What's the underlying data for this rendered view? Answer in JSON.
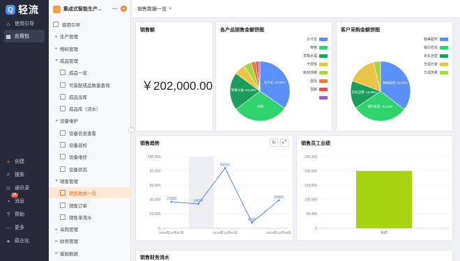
{
  "rail": {
    "logo_text": "轻流",
    "items_top": [
      {
        "label": "使用引导",
        "icon": "home-icon"
      },
      {
        "label": "应用包",
        "icon": "grid-icon"
      }
    ],
    "items_bottom": [
      {
        "label": "创建",
        "icon": "plus-icon"
      },
      {
        "label": "搜索",
        "icon": "search-icon"
      },
      {
        "label": "通讯录",
        "icon": "contacts-icon"
      },
      {
        "label": "消息",
        "icon": "bell-icon",
        "badge": "38"
      },
      {
        "label": "帮助",
        "icon": "help-icon"
      },
      {
        "label": "更多",
        "icon": "more-icon"
      },
      {
        "label": "薛业化",
        "icon": "avatar"
      }
    ]
  },
  "sidebar": {
    "app_name": "集成式智能生产...",
    "more": "···",
    "add": "+",
    "items": [
      {
        "label": "使用引导",
        "level": 1,
        "type": "leaf"
      },
      {
        "label": "生产管理",
        "level": 1,
        "type": "group",
        "open": false
      },
      {
        "label": "物料管理",
        "level": 1,
        "type": "group",
        "open": false
      },
      {
        "label": "成品管理",
        "level": 1,
        "type": "group",
        "open": true
      },
      {
        "label": "成品一览",
        "level": 2,
        "type": "leaf"
      },
      {
        "label": "可装配成品数量查询",
        "level": 2,
        "type": "leaf"
      },
      {
        "label": "成品出库",
        "level": 2,
        "type": "leaf"
      },
      {
        "label": "成品库（流水）",
        "level": 2,
        "type": "leaf"
      },
      {
        "label": "设备维护",
        "level": 1,
        "type": "group",
        "open": true
      },
      {
        "label": "设备信息查看",
        "level": 2,
        "type": "leaf"
      },
      {
        "label": "设备巡检",
        "level": 2,
        "type": "leaf"
      },
      {
        "label": "设备维修",
        "level": 2,
        "type": "leaf"
      },
      {
        "label": "设备状态",
        "level": 2,
        "type": "leaf"
      },
      {
        "label": "销售管理",
        "level": 1,
        "type": "group",
        "open": true
      },
      {
        "label": "销售数据一览",
        "level": 2,
        "type": "leaf",
        "selected": true
      },
      {
        "label": "销售订单",
        "level": 2,
        "type": "leaf"
      },
      {
        "label": "销售单流水",
        "level": 2,
        "type": "leaf"
      },
      {
        "label": "采购管理",
        "level": 1,
        "type": "group",
        "open": false
      },
      {
        "label": "财务管理",
        "level": 1,
        "type": "group",
        "open": false
      },
      {
        "label": "基础数据",
        "level": 1,
        "type": "group",
        "open": false
      }
    ]
  },
  "topbar": {
    "title": "销售数据一览"
  },
  "cards": {
    "sales_amount": {
      "title": "销售额",
      "value": "￥202,000.00"
    },
    "product_pie": {
      "title": "各产品销售金额饼图"
    },
    "customer_pie": {
      "title": "客户采购金额饼图"
    },
    "trend": {
      "title": "销售趋势"
    },
    "salesperson": {
      "title": "销售员工业绩"
    },
    "finance": {
      "title": "销售财务流水"
    }
  },
  "chart_data": [
    {
      "type": "pie",
      "title": "各产品销售金额饼图",
      "categories": [
        "马卡龙",
        "枣糕",
        "草莓大福",
        "千层饼",
        "桃林馒糕",
        "蛋挞",
        "蛋酥",
        ""
      ],
      "values": [
        34.65,
        30.0,
        20.5,
        6.0,
        4.0,
        2.5,
        1.5,
        0.85
      ],
      "slice_labels": [
        "马卡龙: 34.65%",
        "枣糕",
        "草莓大福: 20.53%",
        "",
        "",
        "",
        "",
        ""
      ],
      "colors": [
        "#5b8ff9",
        "#2fd36b",
        "#1b9e5b",
        "#e8c547",
        "#a5d63f",
        "#e87b3f",
        "#e0524a",
        "#9b59c9"
      ],
      "legend_position": "right"
    },
    {
      "type": "pie",
      "title": "客户采购金额饼图",
      "categories": [
        "物美超市",
        "锅行农贸",
        "京东自营",
        "华润万家",
        "华润苏果"
      ],
      "values": [
        35.48,
        30.12,
        15.0,
        15.6,
        3.8
      ],
      "slice_labels": [
        "物美超市: 35.48%",
        "锅行农贸: 30.12%",
        "京东自营: 15.08%",
        "",
        ""
      ],
      "colors": [
        "#5b8ff9",
        "#2fd36b",
        "#1b9e5b",
        "#e8c547",
        "#a5d63f"
      ],
      "legend_position": "right"
    },
    {
      "type": "line",
      "title": "销售趋势",
      "x": [
        "2019年10月01日",
        "2019年11月01日",
        "2019年12月02日",
        "2019年12月10日",
        "2019年12月18日"
      ],
      "xticks": [
        "2019年10月01日",
        "2019年12月02日",
        "2019年12月18日"
      ],
      "values": [
        37000,
        34000,
        84000,
        8000,
        39000
      ],
      "data_labels": [
        "37000",
        "34000",
        "84000",
        "8000",
        "39000"
      ],
      "yticks": [
        "0",
        "20,000",
        "40,000",
        "60,000",
        "80,000",
        "100,000"
      ],
      "ylim": [
        0,
        100000
      ],
      "color": "#4a7fd1",
      "grid": true
    },
    {
      "type": "bar",
      "title": "销售员工业绩",
      "categories": [
        "大红"
      ],
      "values": [
        200000
      ],
      "data_labels": [
        "200000"
      ],
      "yticks": [
        "0",
        "50,000",
        "100,000",
        "150,000",
        "200,000",
        "250,000"
      ],
      "ylim": [
        0,
        250000
      ],
      "color": "#a6d30f",
      "grid": true
    }
  ]
}
